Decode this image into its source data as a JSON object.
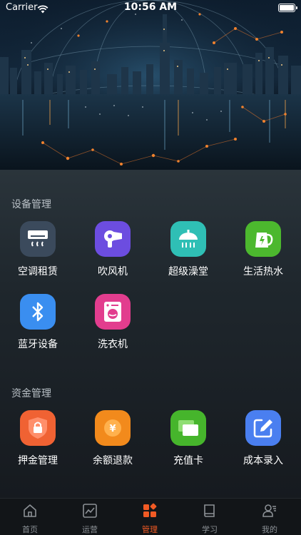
{
  "status_bar": {
    "carrier": "Carrier",
    "time": "10:56 AM"
  },
  "device_section": {
    "title": "设备管理",
    "items": [
      {
        "label": "空调租赁",
        "icon": "air-conditioner-icon",
        "color": "#3b4a5c"
      },
      {
        "label": "吹风机",
        "icon": "hair-dryer-icon",
        "color": "#6c4de0"
      },
      {
        "label": "超级澡堂",
        "icon": "shower-icon",
        "color": "#2fbfb5"
      },
      {
        "label": "生活热水",
        "icon": "kettle-icon",
        "color": "#4cb82e"
      },
      {
        "label": "蓝牙设备",
        "icon": "bluetooth-icon",
        "color": "#3a8ef0"
      },
      {
        "label": "洗衣机",
        "icon": "washing-machine-icon",
        "color": "#e23d8e"
      }
    ]
  },
  "finance_section": {
    "title": "资金管理",
    "items": [
      {
        "label": "押金管理",
        "icon": "deposit-shield-icon",
        "color": "#f06233"
      },
      {
        "label": "余额退款",
        "icon": "yen-coin-icon",
        "color": "#f28a1c"
      },
      {
        "label": "充值卡",
        "icon": "card-icon",
        "color": "#46b52c"
      },
      {
        "label": "成本录入",
        "icon": "edit-icon",
        "color": "#4a7ff0"
      }
    ]
  },
  "tabbar": {
    "active_color": "#f15a24",
    "tabs": [
      {
        "label": "首页",
        "icon": "home-icon"
      },
      {
        "label": "运营",
        "icon": "chart-icon"
      },
      {
        "label": "管理",
        "icon": "grid-icon",
        "active": true
      },
      {
        "label": "学习",
        "icon": "book-icon"
      },
      {
        "label": "我的",
        "icon": "profile-icon"
      }
    ]
  }
}
